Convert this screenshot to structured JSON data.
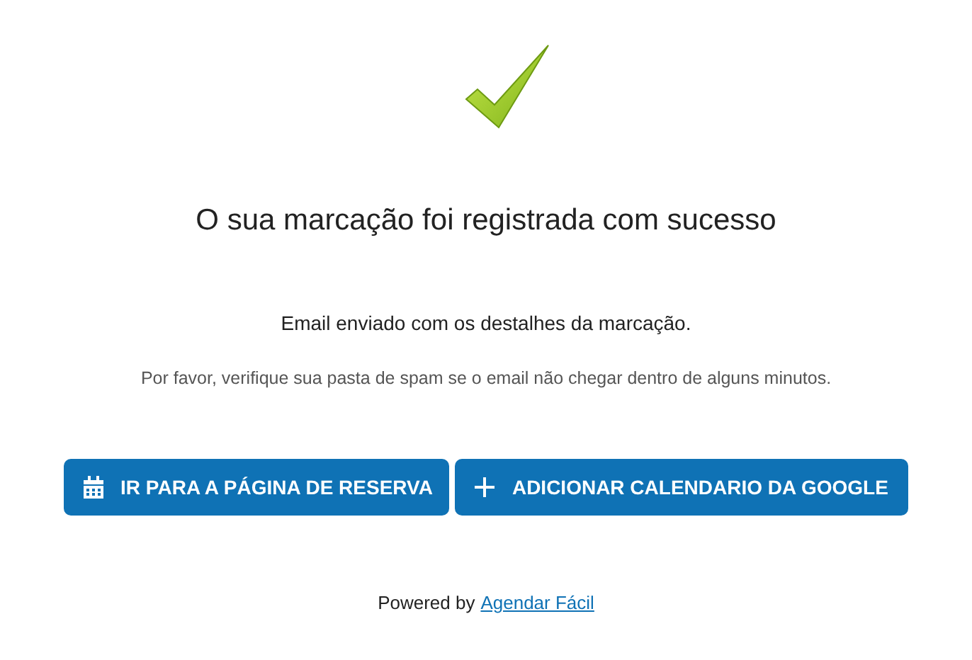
{
  "heading": "O sua marcação foi registrada com sucesso",
  "message": "Email enviado com os destalhes da marcação.",
  "note": "Por favor, verifique sua pasta de spam se o email não chegar dentro de alguns minutos.",
  "buttons": [
    {
      "label": "IR PARA A PÁGINA DE RESERVA"
    },
    {
      "label": "ADICIONAR CALENDARIO DA GOOGLE"
    }
  ],
  "footer": {
    "text": "Powered by",
    "link": "Agendar Fácil"
  }
}
